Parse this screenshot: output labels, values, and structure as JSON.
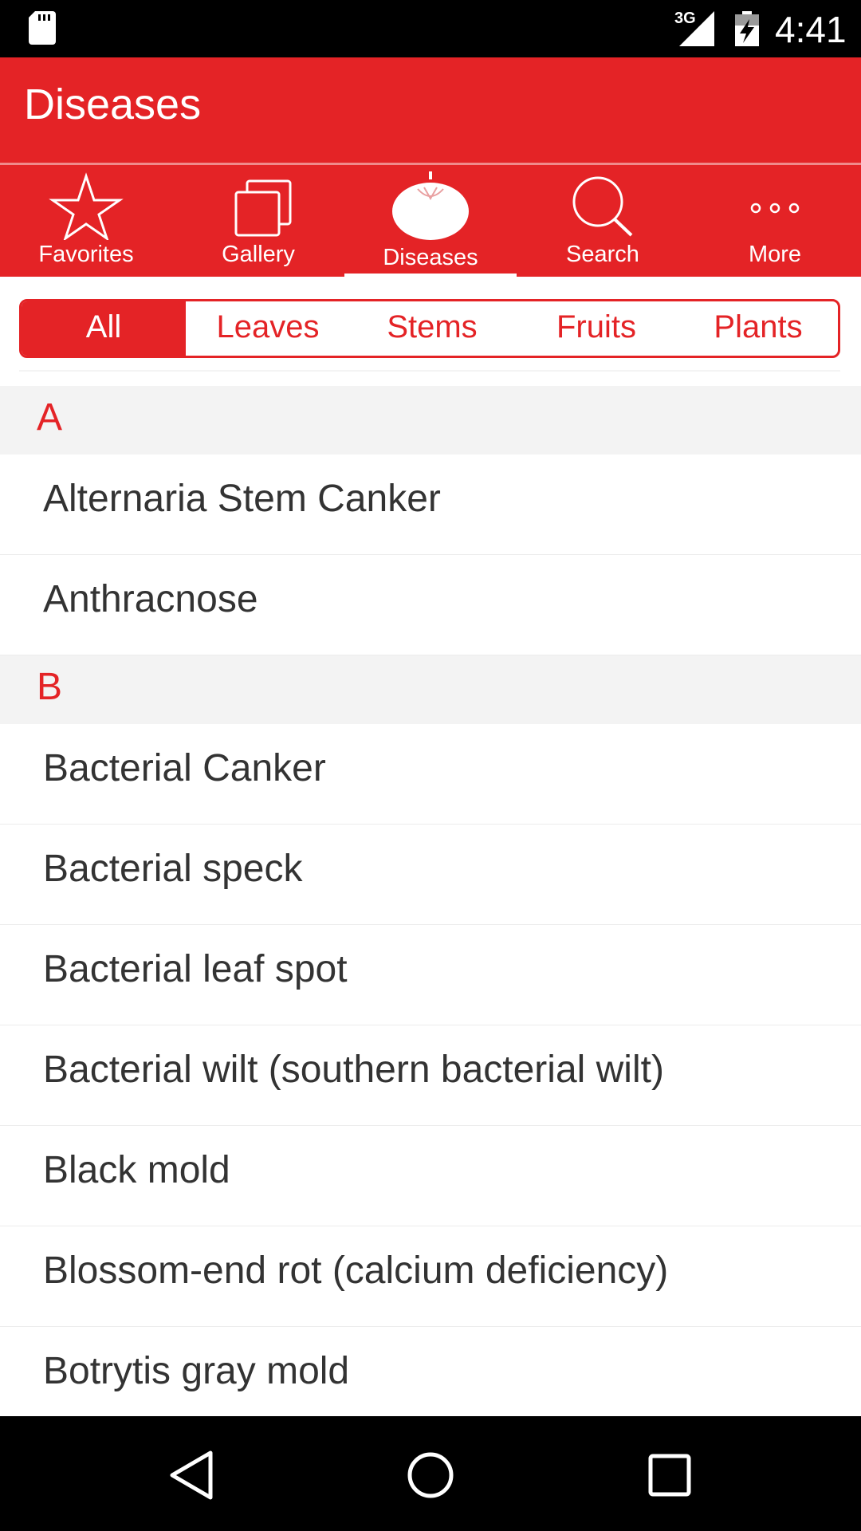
{
  "status_bar": {
    "time": "4:41",
    "network": "3G",
    "icons": [
      "sd-card-icon",
      "signal-icon",
      "battery-charging-icon"
    ]
  },
  "app_bar": {
    "title": "Diseases"
  },
  "tabs": [
    {
      "label": "Favorites",
      "icon": "star-icon"
    },
    {
      "label": "Gallery",
      "icon": "gallery-icon"
    },
    {
      "label": "Diseases",
      "icon": "tomato-icon",
      "active": true
    },
    {
      "label": "Search",
      "icon": "search-icon"
    },
    {
      "label": "More",
      "icon": "more-dots-icon"
    }
  ],
  "filter": {
    "options": [
      "All",
      "Leaves",
      "Stems",
      "Fruits",
      "Plants"
    ],
    "selected": "All"
  },
  "sections": [
    {
      "letter": "A",
      "items": [
        "Alternaria Stem Canker",
        "Anthracnose"
      ]
    },
    {
      "letter": "B",
      "items": [
        "Bacterial Canker",
        "Bacterial speck",
        "Bacterial leaf spot",
        "Bacterial wilt (southern bacterial wilt)",
        "Black mold",
        "Blossom-end rot (calcium deficiency)",
        "Botrytis gray mold"
      ]
    }
  ],
  "colors": {
    "accent": "#e42326",
    "section_bg": "#f3f3f3",
    "text": "#333333"
  },
  "nav_bar": {
    "icons": [
      "back-icon",
      "home-icon",
      "recents-icon"
    ]
  }
}
